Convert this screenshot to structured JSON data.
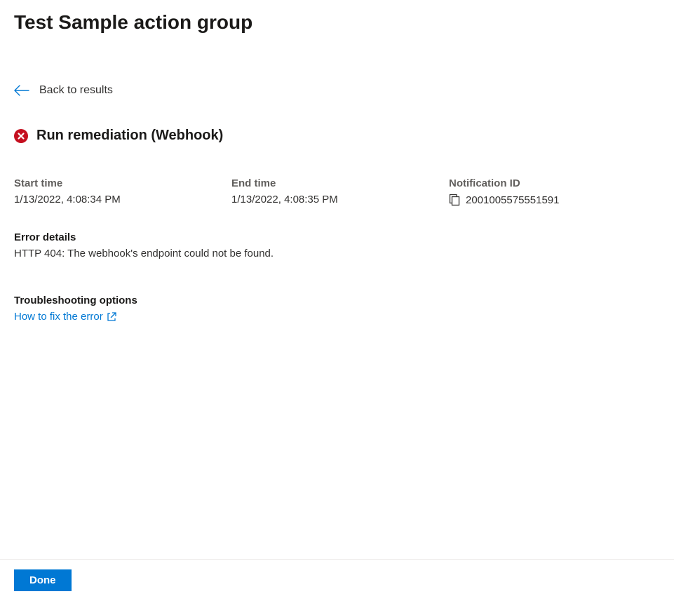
{
  "header": {
    "title": "Test Sample action group"
  },
  "back": {
    "label": "Back to results"
  },
  "colors": {
    "error": "#c50f1f",
    "link": "#0078d4",
    "primary_button": "#0078d4"
  },
  "status": {
    "icon": "error-circle-icon",
    "title": "Run remediation (Webhook)"
  },
  "details": {
    "start_time": {
      "label": "Start time",
      "value": "1/13/2022, 4:08:34 PM"
    },
    "end_time": {
      "label": "End time",
      "value": "1/13/2022, 4:08:35 PM"
    },
    "notification_id": {
      "label": "Notification ID",
      "value": "2001005575551591"
    }
  },
  "error": {
    "heading": "Error details",
    "message": "HTTP 404: The webhook's endpoint could not be found."
  },
  "troubleshooting": {
    "heading": "Troubleshooting options",
    "link_text": "How to fix the error"
  },
  "footer": {
    "done_label": "Done"
  }
}
